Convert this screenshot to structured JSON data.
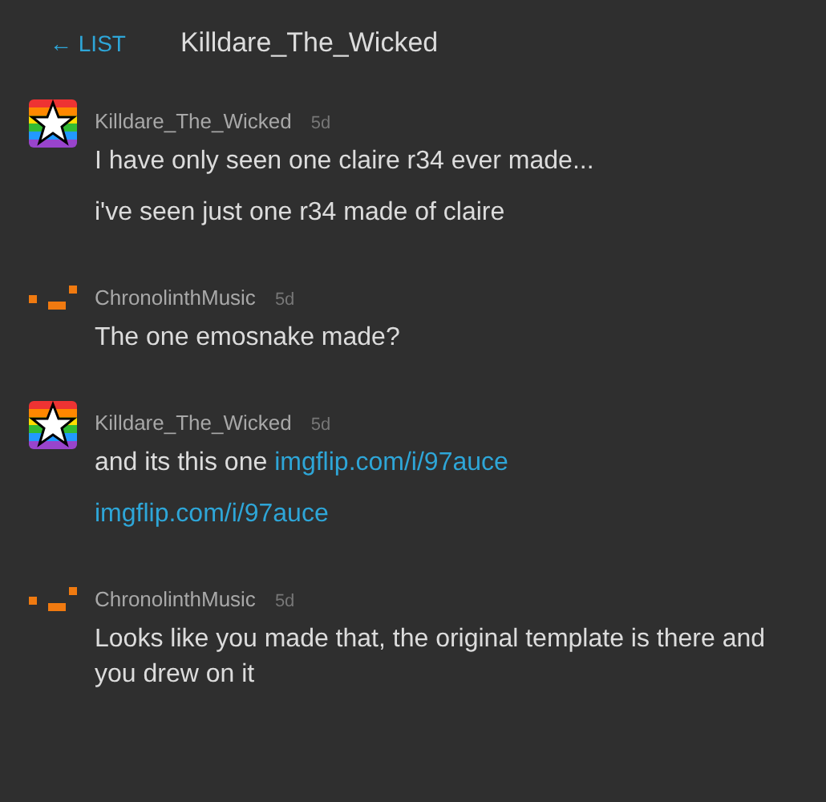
{
  "header": {
    "back_link": "← LIST",
    "title": "Killdare_The_Wicked"
  },
  "messages": [
    {
      "author": "Killdare_The_Wicked",
      "kind": "star",
      "time": "5d",
      "paragraphs": [
        [
          {
            "kind": "text",
            "text": "I have only seen one claire r34 ever made..."
          }
        ],
        [
          {
            "kind": "text",
            "text": "i've seen just one r34 made of claire"
          }
        ]
      ]
    },
    {
      "author": "ChronolinthMusic",
      "kind": "pixels",
      "time": "5d",
      "paragraphs": [
        [
          {
            "kind": "text",
            "text": "The one emosnake made?"
          }
        ]
      ]
    },
    {
      "author": "Killdare_The_Wicked",
      "kind": "star",
      "time": "5d",
      "paragraphs": [
        [
          {
            "kind": "text",
            "text": "and its this one "
          },
          {
            "kind": "link",
            "text": "imgflip.com/i/97auce"
          }
        ],
        [
          {
            "kind": "link",
            "text": "imgflip.com/i/97auce"
          }
        ]
      ]
    },
    {
      "author": "ChronolinthMusic",
      "kind": "pixels",
      "time": "5d",
      "paragraphs": [
        [
          {
            "kind": "text",
            "text": "Looks like you made that, the original template is there and you drew on it"
          }
        ]
      ]
    }
  ]
}
